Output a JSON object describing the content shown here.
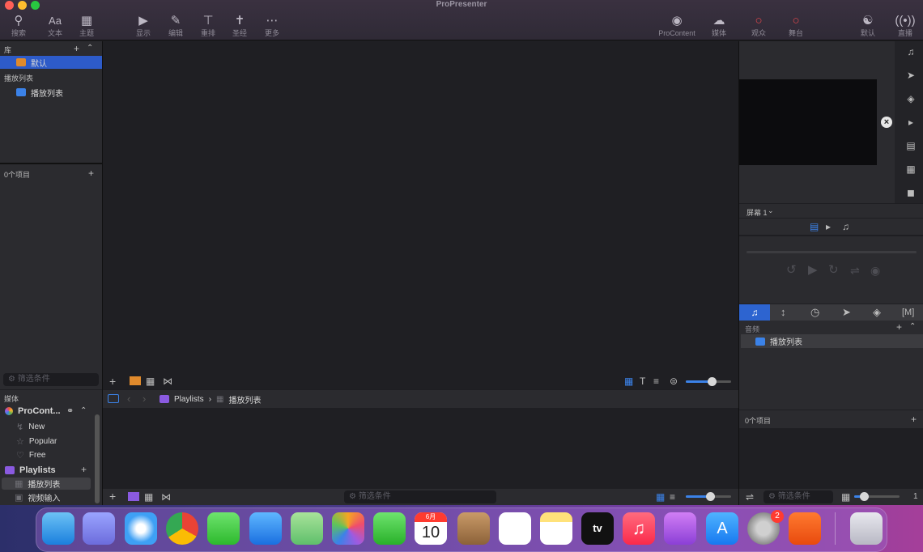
{
  "app": {
    "title": "ProPresenter"
  },
  "toolbar": {
    "search": "搜索",
    "text": "文本",
    "theme": "主题",
    "show": "显示",
    "edit": "编辑",
    "reflow": "重排",
    "bible": "圣经",
    "more": "更多",
    "procontent": "ProContent",
    "media": "媒体",
    "audience": "观众",
    "stage": "舞台",
    "default": "默认",
    "live": "直播"
  },
  "library": {
    "header": "库",
    "default_item": "默认",
    "playlists_header": "播放列表",
    "playlist_item": "播放列表",
    "count": "0个项目"
  },
  "filter": {
    "placeholder": "筛选条件"
  },
  "media_bin": {
    "header": "媒体",
    "procontent": "ProCont...",
    "items": [
      "New",
      "Popular",
      "Free"
    ],
    "playlists": "Playlists",
    "playlist_items": [
      "播放列表",
      "视频输入"
    ]
  },
  "breadcrumb": {
    "root": "Playlists",
    "sep": "›",
    "current": "播放列表"
  },
  "preview": {
    "screen": "屏幕 1"
  },
  "audio": {
    "header": "音频",
    "playlist_item": "播放列表",
    "count": "0个项目",
    "footer_value": "1"
  },
  "dock": {
    "calendar_month": "6月",
    "calendar_day": "10",
    "settings_badge": "2",
    "tv_label": "tv"
  }
}
